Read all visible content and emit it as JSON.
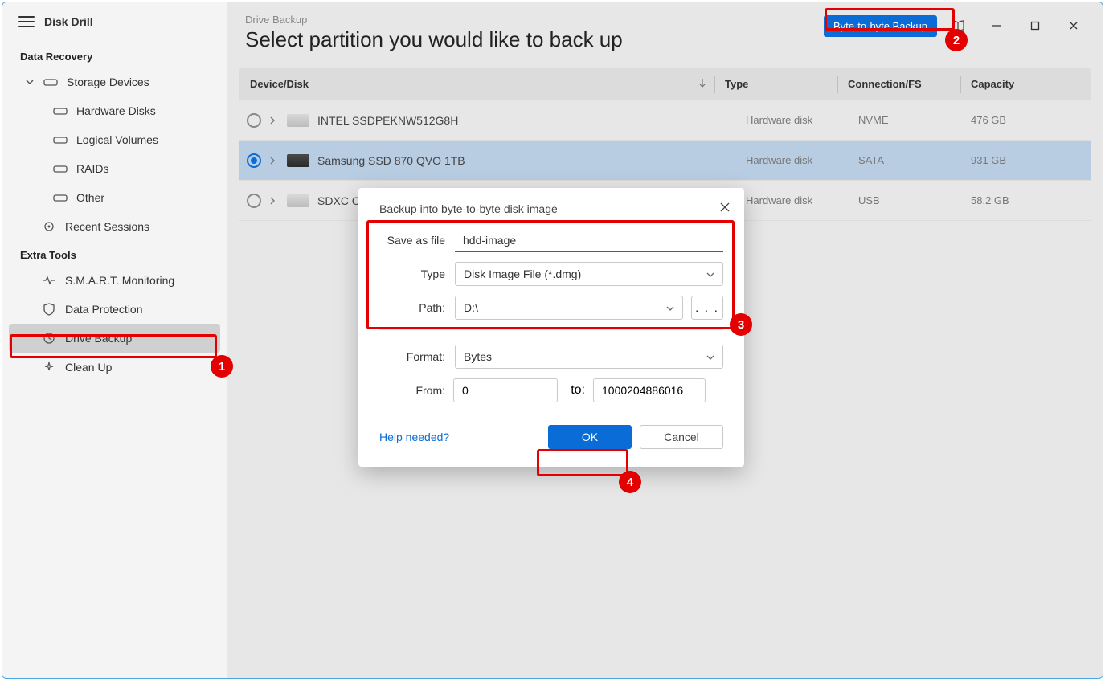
{
  "app": {
    "title": "Disk Drill"
  },
  "sidebar": {
    "section_recovery": "Data Recovery",
    "storage_devices": "Storage Devices",
    "hardware_disks": "Hardware Disks",
    "logical_volumes": "Logical Volumes",
    "raids": "RAIDs",
    "other": "Other",
    "recent_sessions": "Recent Sessions",
    "section_extra": "Extra Tools",
    "smart": "S.M.A.R.T. Monitoring",
    "data_protection": "Data Protection",
    "drive_backup": "Drive Backup",
    "clean_up": "Clean Up"
  },
  "header": {
    "crumb": "Drive Backup",
    "title": "Select partition you would like to back up",
    "byte_button": "Byte-to-byte Backup"
  },
  "table": {
    "col_device": "Device/Disk",
    "col_type": "Type",
    "col_conn": "Connection/FS",
    "col_cap": "Capacity",
    "rows": [
      {
        "name": "INTEL SSDPEKNW512G8H",
        "type": "Hardware disk",
        "conn": "NVME",
        "cap": "476 GB",
        "selected": false
      },
      {
        "name": "Samsung SSD 870 QVO 1TB",
        "type": "Hardware disk",
        "conn": "SATA",
        "cap": "931 GB",
        "selected": true
      },
      {
        "name": "SDXC Card",
        "type": "Hardware disk",
        "conn": "USB",
        "cap": "58.2 GB",
        "selected": false
      }
    ]
  },
  "modal": {
    "title": "Backup into byte-to-byte disk image",
    "save_as_label": "Save as file",
    "save_as_value": "hdd-image",
    "type_label": "Type",
    "type_value": "Disk Image File (*.dmg)",
    "path_label": "Path:",
    "path_value": "D:\\",
    "browse": ". . .",
    "format_label": "Format:",
    "format_value": "Bytes",
    "from_label": "From:",
    "from_value": "0",
    "to_label": "to:",
    "to_value": "1000204886016",
    "help": "Help needed?",
    "ok": "OK",
    "cancel": "Cancel"
  },
  "annotations": {
    "b1": "1",
    "b2": "2",
    "b3": "3",
    "b4": "4"
  }
}
